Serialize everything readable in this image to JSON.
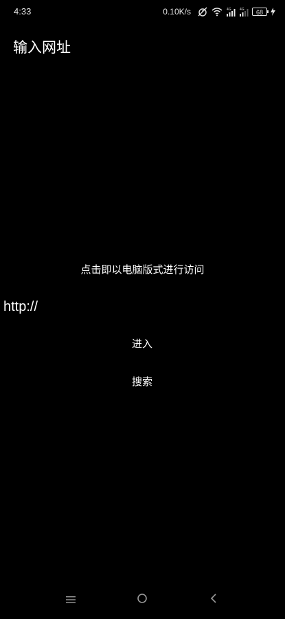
{
  "status_bar": {
    "time": "4:33",
    "net_speed": "0.10K/s",
    "battery": "68",
    "icons": [
      "alarm-off-icon",
      "wifi-icon",
      "signal-4g-icon",
      "signal-4g-icon",
      "charging-icon"
    ]
  },
  "app": {
    "title": "输入网址"
  },
  "main": {
    "desktop_mode_text": "点击即以电脑版式进行访问",
    "url_value": "http://",
    "enter_label": "进入",
    "search_label": "搜索"
  },
  "nav": {
    "icons": [
      "menu-icon",
      "home-icon",
      "back-icon"
    ]
  },
  "colors": {
    "background": "#000000",
    "text": "#ffffff",
    "status_text": "#e6e6e6",
    "nav_icon": "#9a9a9a"
  }
}
